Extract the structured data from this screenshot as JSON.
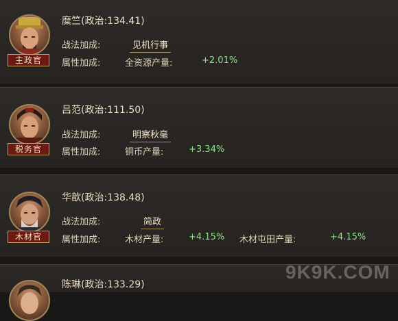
{
  "officials": [
    {
      "name": "糜竺(政治:134.41)",
      "role": "主政官",
      "tactic_label": "战法加成:",
      "tactic": "见机行事",
      "attr_label": "属性加成:",
      "attributes": [
        {
          "text": "全资源产量:",
          "bonus": "+2.01%"
        }
      ]
    },
    {
      "name": "吕范(政治:111.50)",
      "role": "税务官",
      "tactic_label": "战法加成:",
      "tactic": "明察秋毫",
      "attr_label": "属性加成:",
      "attributes": [
        {
          "text": "铜币产量:",
          "bonus": "+3.34%"
        }
      ]
    },
    {
      "name": "华歆(政治:138.48)",
      "role": "木材官",
      "tactic_label": "战法加成:",
      "tactic": "简政",
      "attr_label": "属性加成:",
      "attributes": [
        {
          "text": "木材产量:",
          "bonus": "+4.15%"
        },
        {
          "text": "木材屯田产量:",
          "bonus": "+4.15%"
        }
      ]
    },
    {
      "name": "陈琳(政治:133.29)"
    }
  ],
  "watermark": "9K9K.COM"
}
